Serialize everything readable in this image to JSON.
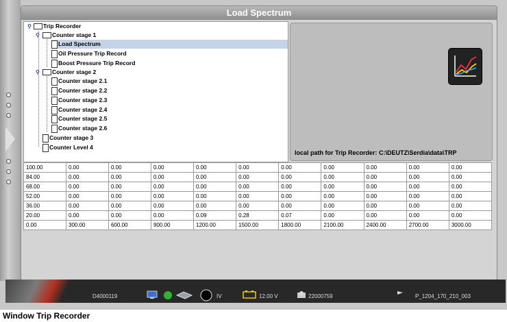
{
  "window": {
    "title": "Load Spectrum"
  },
  "tree": {
    "root": "Trip Recorder",
    "stage1": "Counter stage 1",
    "load": "Load Spectrum",
    "oil": "Oil Pressure Trip Record",
    "boost": "Boost Pressure Trip Record",
    "stage2": "Counter stage 2",
    "s21": "Counter stage 2.1",
    "s22": "Counter stage 2.2",
    "s23": "Counter stage 2.3",
    "s24": "Counter stage 2.4",
    "s25": "Counter stage 2.5",
    "s26": "Counter stage 2.6",
    "stage3": "Counter stage 3",
    "level4": "Counter Level 4"
  },
  "preview": {
    "path_label": "local path for Trip Recorder: C:\\DEUTZ\\Serdia\\data\\TRP",
    "icon": "chart-icon"
  },
  "table": {
    "rows": [
      [
        "100.00",
        "0.00",
        "0.00",
        "0.00",
        "0.00",
        "0.00",
        "0.00",
        "0.00",
        "0.00",
        "0.00",
        "0.00"
      ],
      [
        "84.00",
        "0.00",
        "0.00",
        "0.00",
        "0.00",
        "0.00",
        "0.00",
        "0.00",
        "0.00",
        "0.00",
        "0.00"
      ],
      [
        "68.00",
        "0.00",
        "0.00",
        "0.00",
        "0.00",
        "0.00",
        "0.00",
        "0.00",
        "0.00",
        "0.00",
        "0.00"
      ],
      [
        "52.00",
        "0.00",
        "0.00",
        "0.00",
        "0.00",
        "0.00",
        "0.00",
        "0.00",
        "0.00",
        "0.00",
        "0.00"
      ],
      [
        "36.00",
        "0.00",
        "0.00",
        "0.00",
        "0.00",
        "0.00",
        "0.00",
        "0.00",
        "0.00",
        "0.00",
        "0.00"
      ],
      [
        "20.00",
        "0.00",
        "0.00",
        "0.00",
        "0.09",
        "0.28",
        "0.07",
        "0.00",
        "0.00",
        "0.00",
        "0.00"
      ],
      [
        "0.00",
        "300.00",
        "600.00",
        "900.00",
        "1200.00",
        "1500.00",
        "1800.00",
        "2100.00",
        "2400.00",
        "2700.00",
        "3000.00"
      ]
    ]
  },
  "statusbar": {
    "ecu": "D4000119",
    "mode": "IV",
    "voltage": "12.00 V",
    "counter": "22000759",
    "project": "P_1204_170_210_003"
  },
  "caption": "Window Trip Recorder",
  "colors": {
    "selection": "#c5d3e8",
    "titlebar": "#9c9c9c",
    "status_green": "#2fb52f"
  }
}
